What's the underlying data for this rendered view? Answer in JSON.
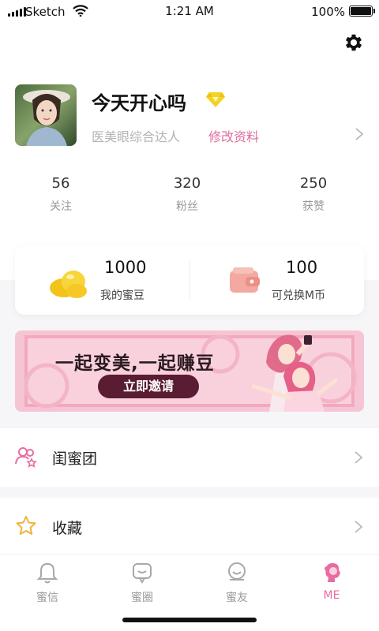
{
  "status_bar": {
    "carrier": "Sketch",
    "time": "1:21 AM",
    "battery": "100%"
  },
  "profile": {
    "nickname": "今天开心吗",
    "tagline": "医美眼综合达人",
    "edit_label": "修改资料"
  },
  "stats": [
    {
      "value": "56",
      "label": "关注"
    },
    {
      "value": "320",
      "label": "粉丝"
    },
    {
      "value": "250",
      "label": "获赞"
    }
  ],
  "wallet": {
    "beans_value": "1000",
    "beans_label": "我的蜜豆",
    "coins_value": "100",
    "coins_label": "可兑换M币"
  },
  "banner": {
    "slogan": "一起变美,一起赚豆",
    "button_label": "立即邀请"
  },
  "menu": [
    {
      "label": "闺蜜团",
      "icon": "friends-icon"
    },
    {
      "label": "收藏",
      "icon": "star-icon"
    }
  ],
  "tabs": [
    {
      "label": "蜜信",
      "icon": "bell-icon",
      "active": false
    },
    {
      "label": "蜜圈",
      "icon": "chat-bubble-icon",
      "active": false
    },
    {
      "label": "蜜友",
      "icon": "smile-face-icon",
      "active": false
    },
    {
      "label": "ME",
      "icon": "girl-profile-icon",
      "active": true
    }
  ],
  "colors": {
    "accent": "#e96ba1",
    "link": "#e06ba0",
    "banner_bg": "#f6c5d3",
    "banner_button": "#5a1c33",
    "muted": "#999999"
  }
}
